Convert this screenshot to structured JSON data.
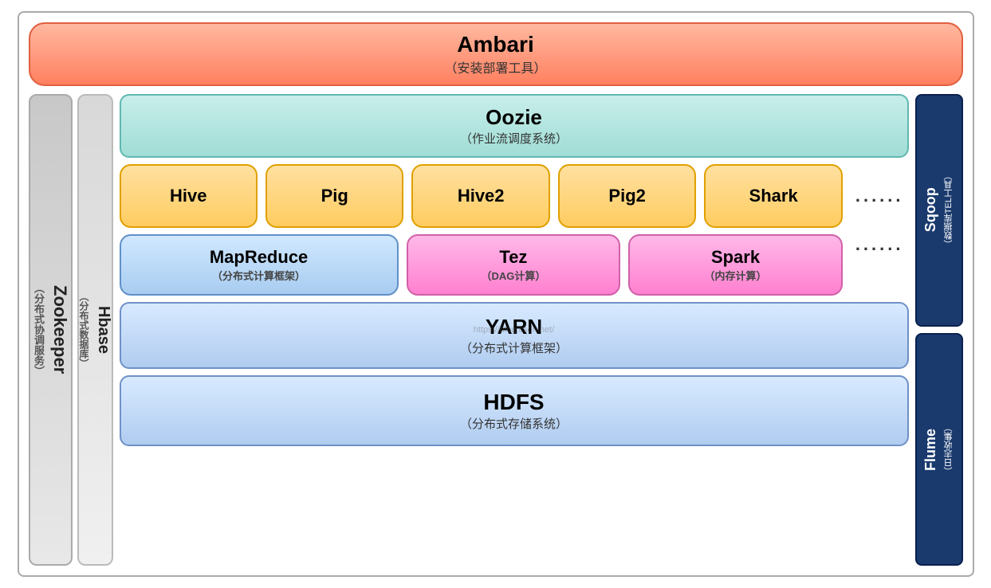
{
  "ambari": {
    "title": "Ambari",
    "subtitle": "（安装部署工具）"
  },
  "zookeeper": {
    "title": "Zookeeper",
    "subtitle": "（分布式协调服务）"
  },
  "hbase": {
    "title": "Hbase",
    "subtitle": "（分布式数据库）"
  },
  "oozie": {
    "title": "Oozie",
    "subtitle": "（作业流调度系统）"
  },
  "tools": [
    {
      "name": "Hive"
    },
    {
      "name": "Pig"
    },
    {
      "name": "Hive2"
    },
    {
      "name": "Pig2"
    },
    {
      "name": "Shark"
    }
  ],
  "dots1": "......",
  "mapreduce": {
    "title": "MapReduce",
    "subtitle": "（分布式计算框架）"
  },
  "tez": {
    "title": "Tez",
    "subtitle": "（DAG计算）"
  },
  "spark": {
    "title": "Spark",
    "subtitle": "（内存计算）"
  },
  "dots2": "......",
  "yarn": {
    "title": "YARN",
    "subtitle": "（分布式计算框架）"
  },
  "hdfs": {
    "title": "HDFS",
    "subtitle": "（分布式存储系统）"
  },
  "sqoop": {
    "title": "Sqoop",
    "subtitle": "（数据库TEL工具）"
  },
  "flume": {
    "title": "Flume",
    "subtitle": "（日志收集）"
  },
  "watermark": "https://blog.csdn.net/"
}
